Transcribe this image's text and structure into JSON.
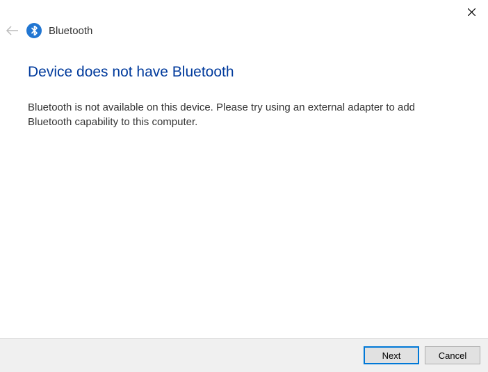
{
  "titlebar": {
    "close_label": "Close"
  },
  "header": {
    "back_label": "Back",
    "icon_name": "bluetooth",
    "title": "Bluetooth"
  },
  "content": {
    "heading": "Device does not have Bluetooth",
    "body": "Bluetooth is not available on this device. Please try using an external adapter to add Bluetooth capability to this computer."
  },
  "footer": {
    "next_label": "Next",
    "cancel_label": "Cancel"
  },
  "colors": {
    "accent": "#0078d7",
    "heading": "#003a9c",
    "bt_icon_bg": "#2176d2"
  }
}
